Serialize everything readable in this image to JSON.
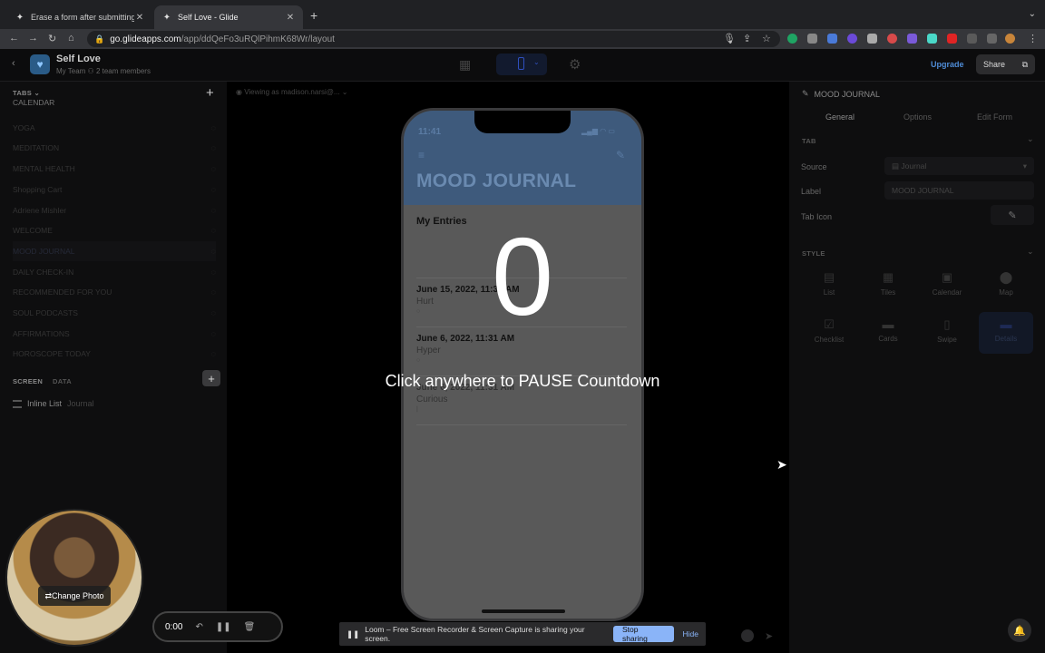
{
  "browser": {
    "tabs": [
      {
        "title": "Erase a form after submitting d"
      },
      {
        "title": "Self Love - Glide"
      }
    ],
    "url_host": "go.glideapps.com",
    "url_path": "/app/ddQeFo3uRQlPihmK68Wr/layout"
  },
  "app": {
    "name": "Self Love",
    "team": "My Team",
    "members": "2 team members",
    "upgrade": "Upgrade",
    "share": "Share"
  },
  "left": {
    "tabs_heading": "TABS",
    "items": [
      "CALENDAR",
      "YOGA",
      "MEDITATION",
      "MENTAL HEALTH",
      "Shopping Cart",
      "Adriene Mishler",
      "WELCOME",
      "MOOD JOURNAL",
      "DAILY CHECK-IN",
      "RECOMMENDED FOR YOU",
      "SOUL PODCASTS",
      "AFFIRMATIONS",
      "HOROSCOPE TODAY"
    ],
    "screen_tab": "SCREEN",
    "data_tab": "DATA",
    "component_name": "Inline List",
    "component_source": "Journal"
  },
  "center": {
    "viewing_as": "Viewing as madison.narsi@...",
    "phone_time": "11:41",
    "phone_title": "MOOD JOURNAL",
    "section_title": "My Entries",
    "entries": [
      {
        "date": "June 15, 2022, 11:31 AM",
        "mood": "Hurt",
        "marker": "○"
      },
      {
        "date": "June 6, 2022, 11:31 AM",
        "mood": "Hyper",
        "marker": "○"
      },
      {
        "date": "June 6, 2022, 11:31 AM",
        "mood": "Curious",
        "marker": "|"
      }
    ]
  },
  "overlay": {
    "countdown": "0",
    "hint": "Click anywhere to PAUSE Countdown"
  },
  "right": {
    "panel_title": "MOOD JOURNAL",
    "tabs": [
      "General",
      "Options",
      "Edit Form"
    ],
    "tab_section": "TAB",
    "source_label": "Source",
    "source_value": "Journal",
    "label_label": "Label",
    "label_value": "MOOD JOURNAL",
    "icon_label": "Tab Icon",
    "style_section": "STYLE",
    "styles": [
      "List",
      "Tiles",
      "Calendar",
      "Map",
      "Checklist",
      "Cards",
      "Swipe",
      "Details"
    ]
  },
  "recorder": {
    "time": "0:00",
    "change_photo": "Change Photo",
    "loom_text": "Loom – Free Screen Recorder & Screen Capture is sharing your screen.",
    "stop_sharing": "Stop sharing",
    "hide": "Hide"
  }
}
